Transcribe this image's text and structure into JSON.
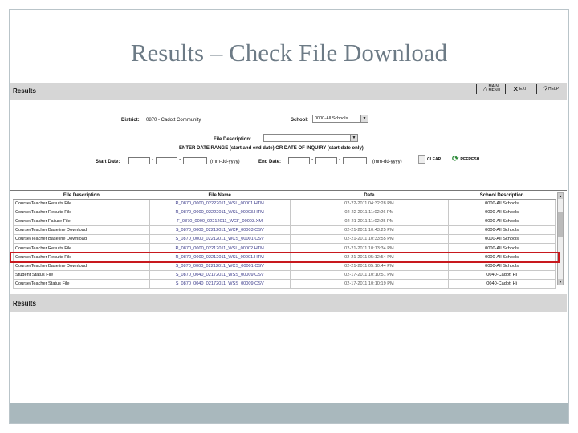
{
  "slide_title": "Results – Check File Download",
  "header": {
    "title": "Results",
    "links": [
      {
        "label": "MAIN MENU",
        "icon": "home-icon"
      },
      {
        "label": "EXIT",
        "icon": "exit-icon"
      },
      {
        "label": "HELP",
        "icon": "help-icon"
      }
    ]
  },
  "form": {
    "district_label": "District:",
    "district_value": "0870 - Cadott Community",
    "school_label": "School:",
    "school_value": "0000-All Schools",
    "file_desc_label": "File Description:",
    "file_desc_value": "",
    "range_note": "ENTER DATE RANGE (start and end date) OR DATE OF INQUIRY (start date only)",
    "start_label": "Start Date:",
    "end_label": "End Date:",
    "date_hint": "(mm-dd-yyyy)",
    "clear_label": "CLEAR",
    "refresh_label": "REFRESH"
  },
  "grid": {
    "columns": [
      "File Description",
      "File Name",
      "Date",
      "School Description"
    ],
    "rows": [
      [
        "Course/Teacher Results File",
        "R_0870_0000_02222011_WSL_00001.HTM",
        "02-22-2011 04:32:28 PM",
        "0000-All Schools"
      ],
      [
        "Course/Teacher Results File",
        "R_0870_0000_02222011_WSL_00003.HTM",
        "02-22-2011 11:02:26 PM",
        "0000-All Schools"
      ],
      [
        "Course/Teacher Failure File",
        "F_0870_0000_02212011_WCF_00003.XM",
        "02-21-2011 11:02:25 PM",
        "0000-All Schools"
      ],
      [
        "Course/Teacher Baseline Download",
        "S_0870_0000_02212011_WCF_00003.CSV",
        "02-21-2011 10:43:25 PM",
        "0000-All Schools"
      ],
      [
        "Course/Teacher Baseline Download",
        "S_0870_0000_02212011_WCS_00001.CSV",
        "02-21-2011 10:33:55 PM",
        "0000-All Schools"
      ],
      [
        "Course/Teacher Results File",
        "R_0870_0000_02212011_WSL_00002.HTM",
        "02-21-2011 10:13:34 PM",
        "0000-All Schools"
      ],
      [
        "Course/Teacher Results File",
        "R_0870_0000_02212011_WSL_00001.HTM",
        "02-21-2011 05:12:54 PM",
        "0000-All Schools"
      ],
      [
        "Course/Teacher Baseline Download",
        "S_0870_0000_02212011_WCS_00001.CSV",
        "02-21-2011 05:10:44 PM",
        "0000-All Schools"
      ],
      [
        "Student Status File",
        "S_0870_0040_02172011_WSS_00009.CSV",
        "02-17-2011 10:10:51 PM",
        "0040-Cadott Hi"
      ],
      [
        "Course/Teacher Status File",
        "S_0870_0040_02172011_WSS_00009.CSV",
        "02-17-2011 10:10:19 PM",
        "0040-Cadott Hi"
      ]
    ]
  },
  "footer": {
    "title": "Results"
  },
  "colors": {
    "highlight": "#c8191e",
    "bar": "#d6d6d6",
    "strip": "#a9b8bd",
    "title": "#6d7b86"
  }
}
